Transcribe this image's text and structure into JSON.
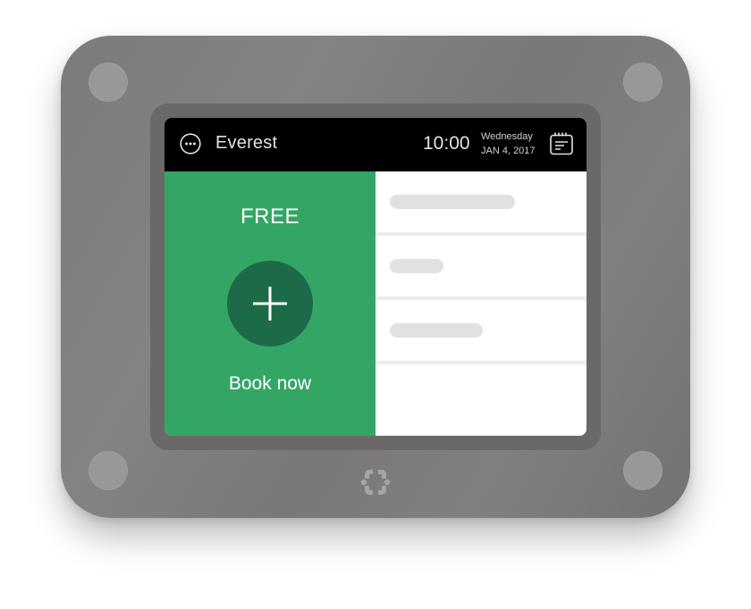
{
  "device": {
    "body_color": "#7d7b79",
    "screw_color": "#9a9896",
    "logo_icon": "brand-logo-icon"
  },
  "header": {
    "menu_icon": "more-horizontal-circle-icon",
    "room_name": "Everest",
    "time": "10:00",
    "day": "Wednesday",
    "date": "JAN 4, 2017",
    "calendar_icon": "calendar-icon",
    "background": "#000000"
  },
  "status": {
    "label": "FREE",
    "book_icon": "plus-icon",
    "book_label": "Book now",
    "color": "#33a666",
    "button_color": "#1c6a48"
  },
  "events": {
    "placeholders": [
      {
        "type": "loading-placeholder"
      },
      {
        "type": "loading-placeholder"
      },
      {
        "type": "loading-placeholder"
      }
    ],
    "placeholder_color": "#e1e1e1"
  }
}
